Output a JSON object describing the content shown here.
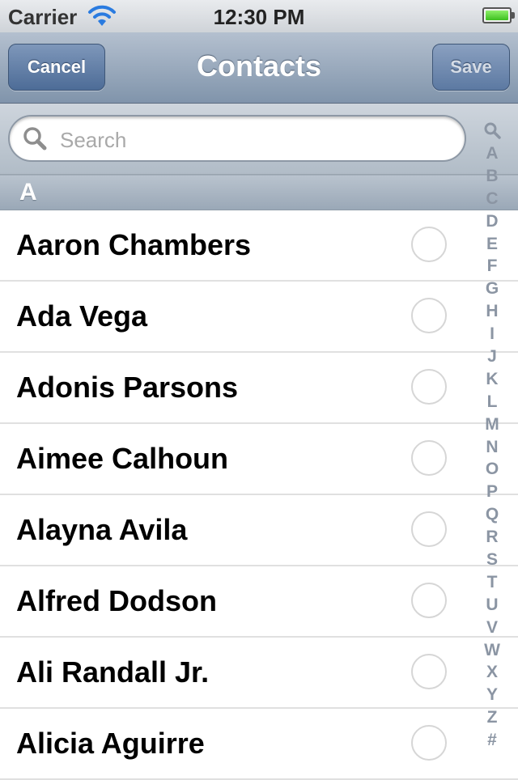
{
  "status_bar": {
    "carrier": "Carrier",
    "time": "12:30 PM"
  },
  "nav": {
    "title": "Contacts",
    "cancel_label": "Cancel",
    "save_label": "Save"
  },
  "search": {
    "placeholder": "Search"
  },
  "section": {
    "letter": "A"
  },
  "contacts": [
    {
      "name": "Aaron Chambers"
    },
    {
      "name": "Ada Vega"
    },
    {
      "name": "Adonis Parsons"
    },
    {
      "name": "Aimee Calhoun"
    },
    {
      "name": "Alayna Avila"
    },
    {
      "name": "Alfred Dodson"
    },
    {
      "name": "Ali Randall Jr."
    },
    {
      "name": "Alicia Aguirre"
    }
  ],
  "index": [
    "A",
    "B",
    "C",
    "D",
    "E",
    "F",
    "G",
    "H",
    "I",
    "J",
    "K",
    "L",
    "M",
    "N",
    "O",
    "P",
    "Q",
    "R",
    "S",
    "T",
    "U",
    "V",
    "W",
    "X",
    "Y",
    "Z",
    "#"
  ],
  "colors": {
    "nav_tint": "#8094ab",
    "battery_fill": "#3cbf1e",
    "index_text": "#8b95a3"
  }
}
